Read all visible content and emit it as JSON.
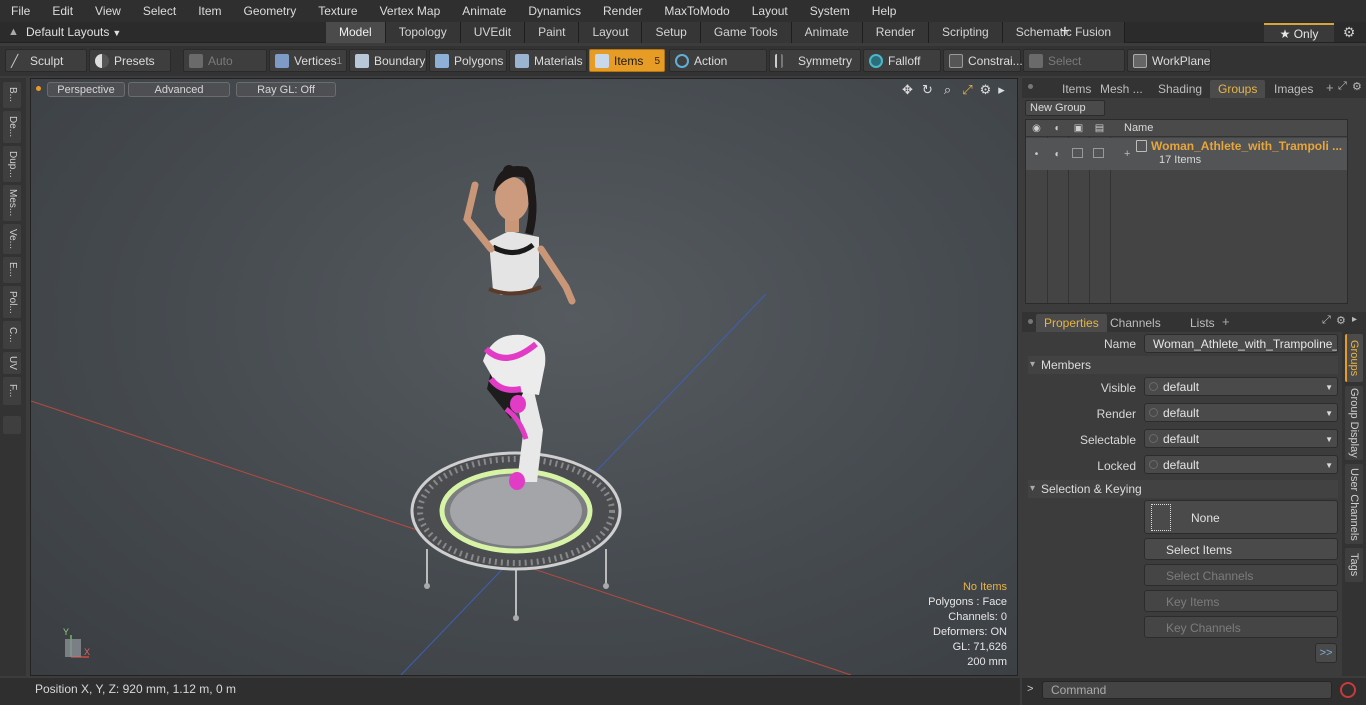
{
  "menu": [
    "File",
    "Edit",
    "View",
    "Select",
    "Item",
    "Geometry",
    "Texture",
    "Vertex Map",
    "Animate",
    "Dynamics",
    "Render",
    "MaxToModo",
    "Layout",
    "System",
    "Help"
  ],
  "layouts": {
    "label": "Default Layouts"
  },
  "tabs": [
    "Model",
    "Topology",
    "UVEdit",
    "Paint",
    "Layout",
    "Setup",
    "Game Tools",
    "Animate",
    "Render",
    "Scripting",
    "Schematic Fusion"
  ],
  "active_tab": "Model",
  "only_label": "★ Only",
  "toolbar": {
    "sculpt": "Sculpt",
    "presets": "Presets",
    "auto_select": "Auto Select",
    "vertices": "Vertices",
    "vertices_count": "1",
    "boundary": "Boundary",
    "polygons": "Polygons",
    "materials": "Materials",
    "items": "Items",
    "items_count": "5",
    "action_center": "Action Center",
    "symmetry": "Symmetry",
    "falloff": "Falloff",
    "constraints": "Constrai...",
    "select_through": "Select Through",
    "workplane": "WorkPlane"
  },
  "left_tabs": [
    "B...",
    "De...",
    "Dup...",
    "Mes...",
    "Ve...",
    "E...",
    "Pol...",
    "C...",
    "UV",
    "F..."
  ],
  "viewport": {
    "perspective": "Perspective",
    "advanced": "Advanced",
    "raygl": "Ray GL: Off",
    "info": {
      "no_items": "No Items",
      "polygons": "Polygons : Face",
      "channels": "Channels: 0",
      "deformers": "Deformers: ON",
      "gl": "GL: 71,626",
      "scale": "200 mm"
    }
  },
  "status": {
    "position": "Position X, Y, Z:  920 mm, 1.12 m, 0 m"
  },
  "right_tabs": [
    "Items",
    "Mesh ...",
    "Shading",
    "Groups",
    "Images"
  ],
  "groups": {
    "new_group": "New Group",
    "col_name": "Name",
    "row_name": "Woman_Athlete_with_Trampoli ...",
    "row_count": "17 Items"
  },
  "prop_tabs": [
    "Properties",
    "Channels",
    "Lists"
  ],
  "properties": {
    "name_label": "Name",
    "name_value": "Woman_Athlete_with_Trampoline_Jun",
    "members": "Members",
    "visible_label": "Visible",
    "visible": "default",
    "render_label": "Render",
    "render": "default",
    "selectable_label": "Selectable",
    "selectable": "default",
    "locked_label": "Locked",
    "locked": "default",
    "sel_keying": "Selection & Keying",
    "none_btn": "None",
    "select_items": "Select Items",
    "select_channels": "Select Channels",
    "key_items": "Key Items",
    "key_channels": "Key Channels",
    "more": ">>"
  },
  "right_vtabs": [
    "Groups",
    "Group Display",
    "User Channels",
    "Tags"
  ],
  "command": {
    "placeholder": "Command"
  }
}
